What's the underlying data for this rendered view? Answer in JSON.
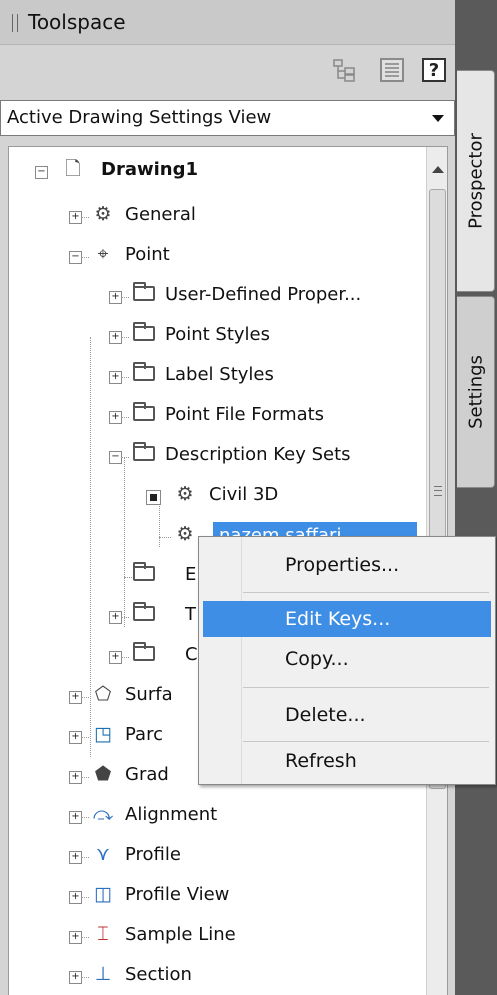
{
  "window": {
    "title": "Toolspace"
  },
  "side_tabs": [
    "Prospector",
    "Settings"
  ],
  "view_select": {
    "value": "Active Drawing Settings View"
  },
  "tree": {
    "drawing": "Drawing1",
    "general": "General",
    "point": "Point",
    "user_defined": "User-Defined Proper...",
    "point_styles": "Point Styles",
    "label_styles": "Label Styles",
    "point_file_formats": "Point File Formats",
    "description_key_sets": "Description Key Sets",
    "civil3d": "Civil 3D",
    "nazem": "nazem saffari",
    "e_partial": "E",
    "t_partial": "T",
    "c_partial": "C",
    "surface_partial": "Surfa",
    "parcel_partial": "Parc",
    "grading_partial": "Grad",
    "alignment": "Alignment",
    "profile": "Profile",
    "profile_view": "Profile View",
    "sample_line": "Sample Line",
    "section": "Section"
  },
  "context_menu": {
    "properties": "Properties...",
    "edit_keys": "Edit Keys...",
    "copy": "Copy...",
    "delete": "Delete...",
    "refresh": "Refresh"
  },
  "toolbar": {
    "help": "?"
  },
  "colors": {
    "accent": "#3f8ee6",
    "panel": "#d4d4d4"
  }
}
